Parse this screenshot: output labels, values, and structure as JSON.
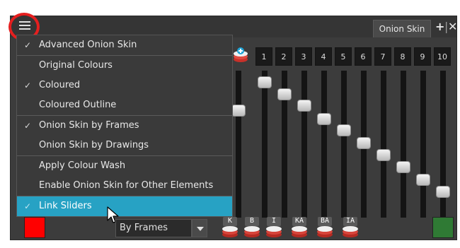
{
  "window": {
    "tab_label": "Onion Skin",
    "add_icon": "plus-icon",
    "close_icon": "close-icon"
  },
  "menu_button": {
    "icon": "hamburger-menu-icon"
  },
  "frame_numbers": [
    "1",
    "2",
    "3",
    "4",
    "5",
    "6",
    "7",
    "8",
    "9",
    "10"
  ],
  "menu": {
    "items": [
      {
        "label": "Advanced Onion Skin",
        "checked": true,
        "highlighted": false
      },
      {
        "label": "Original Colours",
        "checked": false,
        "highlighted": false
      },
      {
        "label": "Coloured",
        "checked": true,
        "highlighted": false
      },
      {
        "label": "Coloured Outline",
        "checked": false,
        "highlighted": false
      },
      {
        "label": "Onion Skin by Frames",
        "checked": true,
        "highlighted": false
      },
      {
        "label": "Onion Skin by Drawings",
        "checked": false,
        "highlighted": false
      },
      {
        "label": "Apply Colour Wash",
        "checked": false,
        "highlighted": false
      },
      {
        "label": "Enable Onion Skin for Other Elements",
        "checked": false,
        "highlighted": false
      },
      {
        "label": "Link Sliders",
        "checked": true,
        "highlighted": true
      }
    ],
    "check_glyph": "✓"
  },
  "bottom": {
    "previous_colour": "#ff0000",
    "next_colour": "#2f7a34",
    "mode_select_value": "By Frames",
    "skin_buttons": [
      "K",
      "B",
      "I",
      "KA",
      "BA",
      "IA"
    ]
  },
  "colors": {
    "highlight": "#27a2c4",
    "annotation_ring": "#e51f1f"
  }
}
